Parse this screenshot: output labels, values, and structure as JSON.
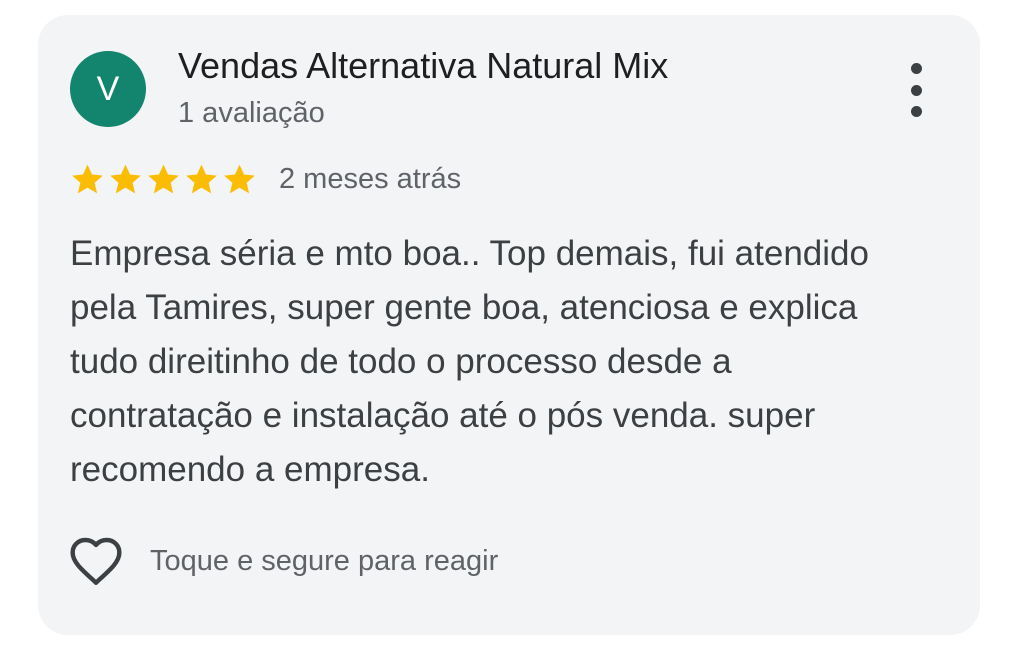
{
  "review": {
    "author": {
      "initial": "V",
      "name": "Vendas Alternativa Natural Mix",
      "review_count": "1 avaliação",
      "avatar_color": "#13846e"
    },
    "rating": 5,
    "max_rating": 5,
    "star_color": "#fbbc04",
    "time_ago": "2 meses atrás",
    "text": "Empresa séria e mto boa.. Top demais, fui atendido\npela Tamires, super gente boa, atenciosa e explica\ntudo direitinho de todo o processo desde a\ncontratação e instalação até o pós venda. super\nrecomendo a empresa.",
    "more_menu_icon": "more-vert-icon",
    "react": {
      "icon": "heart-outline-icon",
      "label": "Toque e segure para reagir"
    }
  }
}
